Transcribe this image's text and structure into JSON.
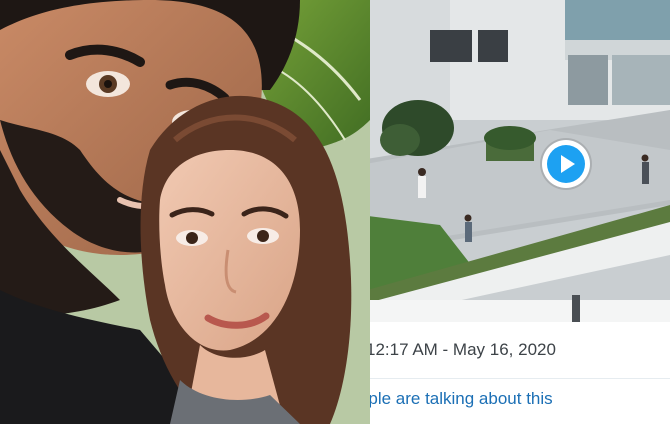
{
  "tweet": {
    "timestamp": "12:17 AM - May 16, 2020",
    "engagement_link": "people are talking about this",
    "accent_color": "#1da1f2",
    "link_color": "#1b6fb5"
  },
  "video": {
    "play_icon": "play-icon"
  },
  "photo": {
    "subject": "couple-selfie-photo"
  }
}
